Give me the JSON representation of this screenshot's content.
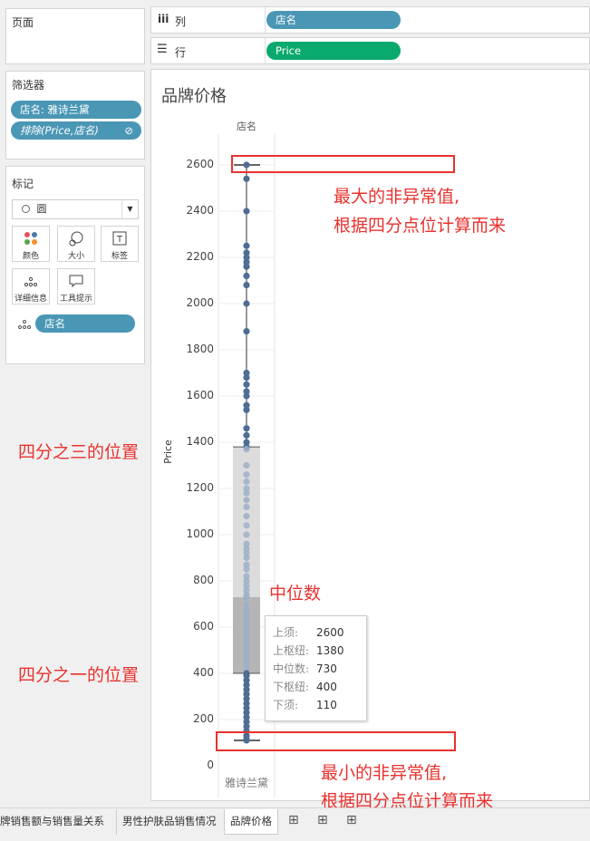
{
  "pages_label": "页面",
  "columns": {
    "icon": "iii",
    "label": "列",
    "pill": "店名"
  },
  "rows": {
    "icon": "☰",
    "label": "行",
    "pill": "Price"
  },
  "filters": {
    "title": "筛选器",
    "items": [
      "店名: 雅诗兰黛",
      "排除(Price,店名)"
    ]
  },
  "marks": {
    "title": "标记",
    "type": "圆",
    "buttons": [
      {
        "label": "颜色",
        "icon": "color-dots-icon"
      },
      {
        "label": "大小",
        "icon": "size-icon"
      },
      {
        "label": "标签",
        "icon": "label-T-icon"
      },
      {
        "label": "详细信息",
        "icon": "detail-dots-icon"
      },
      {
        "label": "工具提示",
        "icon": "tooltip-icon"
      }
    ],
    "field_pill": "店名"
  },
  "view": {
    "title": "品牌价格",
    "column_header": "店名",
    "y_axis_label": "Price",
    "y_ticks": [
      "2600",
      "2400",
      "2200",
      "2000",
      "1800",
      "1600",
      "1400",
      "1200",
      "1000",
      "800",
      "600",
      "400",
      "200",
      "0"
    ],
    "x_category": "雅诗兰黛"
  },
  "tooltip": [
    {
      "key": "上须:",
      "value": "2600"
    },
    {
      "key": "上枢纽:",
      "value": "1380"
    },
    {
      "key": "中位数:",
      "value": "730"
    },
    {
      "key": "下枢纽:",
      "value": "400"
    },
    {
      "key": "下须:",
      "value": "110"
    }
  ],
  "annotations": {
    "max": [
      "最大的非异常值,",
      "根据四分点位计算而来"
    ],
    "q3": "四分之三的位置",
    "median": "中位数",
    "q1": "四分之一的位置",
    "min": [
      "最小的非异常值,",
      "根据四分点位计算而来"
    ]
  },
  "tabs": [
    "牌销售额与销售量关系",
    "男性护肤品销售情况",
    "品牌价格"
  ],
  "colors": {
    "accent_red": "#e8322e",
    "dot": "#4e6d94",
    "pill_blue": "#4a97b5",
    "pill_green": "#0aa96d"
  },
  "chart_data": {
    "type": "boxplot",
    "categories": [
      "雅诗兰黛"
    ],
    "ylabel": "Price",
    "ylim": [
      0,
      2600
    ],
    "box": {
      "upper_whisker": 2600,
      "upper_hinge": 1380,
      "median": 730,
      "lower_hinge": 400,
      "lower_whisker": 110
    },
    "points": [
      2600,
      2540,
      2400,
      2250,
      2220,
      2200,
      2180,
      2160,
      2120,
      2080,
      2000,
      1880,
      1700,
      1680,
      1650,
      1620,
      1600,
      1560,
      1540,
      1460,
      1430,
      1400,
      1380,
      1370,
      1300,
      1260,
      1230,
      1200,
      1180,
      1150,
      1120,
      1080,
      1040,
      1000,
      960,
      940,
      920,
      900,
      870,
      850,
      820,
      800,
      780,
      760,
      740,
      730,
      700,
      680,
      660,
      640,
      620,
      600,
      580,
      560,
      540,
      520,
      500,
      480,
      460,
      440,
      420,
      400,
      390,
      370,
      350,
      330,
      310,
      290,
      270,
      250,
      230,
      210,
      190,
      170,
      150,
      130,
      115,
      110
    ],
    "grid": true
  }
}
